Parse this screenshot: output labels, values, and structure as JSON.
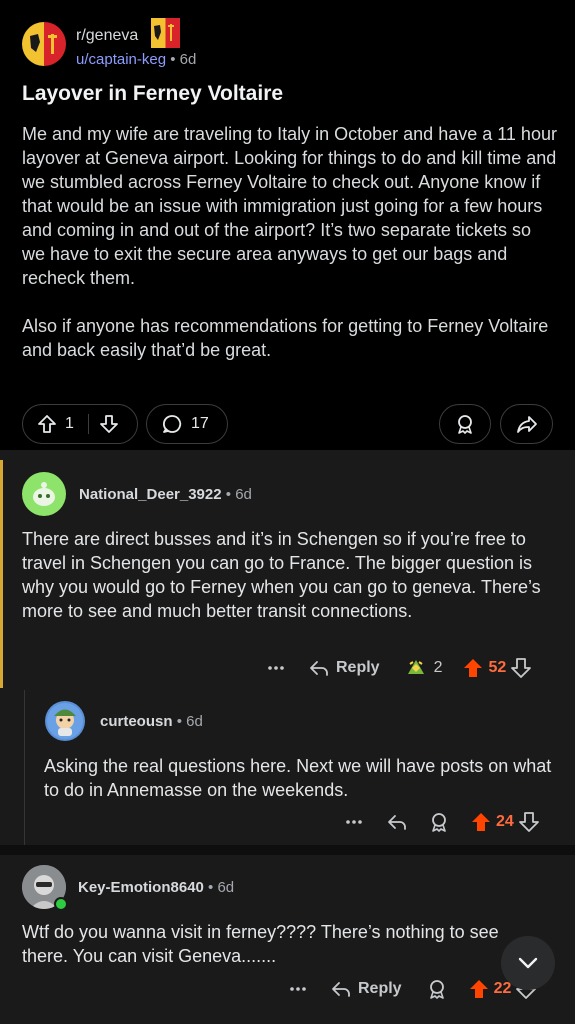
{
  "post": {
    "subreddit": "r/geneva",
    "author": "u/captain-keg",
    "age": "6d",
    "title": "Layover in Ferney Voltaire",
    "body": "Me and my wife are traveling to Italy in October and have a 11 hour layover at Geneva airport. Looking for things to do and kill time and we stumbled across Ferney Voltaire to check out. Anyone know if that would be an issue with immigration just going for a few hours and coming in and out of the airport? It’s two separate tickets so we have to exit the secure area anyways to get our bags and recheck them.\n\nAlso if anyone has recommendations for getting to Ferney Voltaire and back easily that’d be great.",
    "score": "1",
    "comments": "17"
  },
  "comments": [
    {
      "author": "National_Deer_3922",
      "age": "6d",
      "text": "There are direct busses and it’s in Schengen so if you’re free to travel in Schengen you can go to France. The bigger question is why you would go to Ferney when you can go to geneva. There’s more to see and much better transit connections.",
      "reply_label": "Reply",
      "awards": "2",
      "score": "52"
    },
    {
      "author": "curteousn",
      "age": "6d",
      "text": "Asking the real questions here. Next we will have posts on what to do in Annemasse on the weekends.",
      "score": "24"
    },
    {
      "author": "Key-Emotion8640",
      "age": "6d",
      "text": "Wtf do you wanna visit in ferney???? There’s nothing to see there. You can visit Geneva.......",
      "reply_label": "Reply",
      "score": "22"
    }
  ],
  "icons": [
    "upvote-icon",
    "downvote-icon",
    "comment-icon",
    "award-icon",
    "share-icon",
    "more-icon",
    "reply-icon",
    "chevron-down-icon"
  ],
  "colors": {
    "upvote": "#ff4500",
    "link": "#8c9dff",
    "thread_highlight": "#d7a832"
  }
}
